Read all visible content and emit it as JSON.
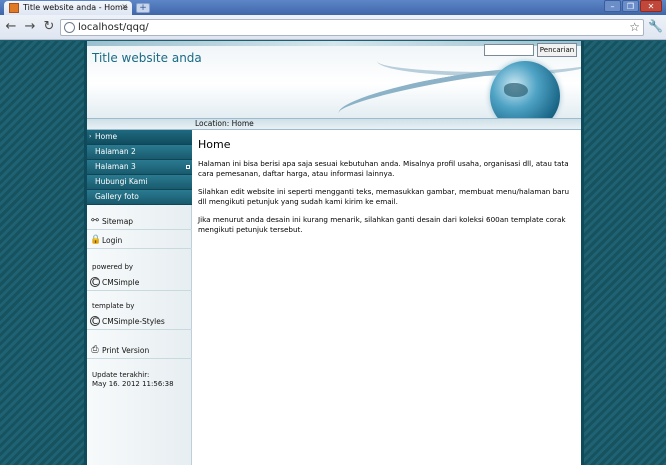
{
  "browser": {
    "tab_title": "Title website anda - Home",
    "tab_close": "×",
    "new_tab": "+",
    "window_min": "–",
    "window_max": "❐",
    "window_close": "✕",
    "back": "←",
    "forward": "→",
    "reload": "↻",
    "url": "localhost/qqq/",
    "bookmark_star": "☆",
    "settings": "🔧"
  },
  "site": {
    "title": "Title website anda",
    "search": {
      "value": "",
      "button_label": "Pencarian"
    },
    "location_label": "Location:  Home"
  },
  "sidebar": {
    "menu": [
      {
        "label": "Home",
        "active": true
      },
      {
        "label": "Halaman 2"
      },
      {
        "label": "Halaman 3",
        "has_submenu": true
      },
      {
        "label": "Hubungi Kami"
      },
      {
        "label": "Gallery foto"
      }
    ],
    "links": {
      "sitemap": {
        "icon": "sitemap-icon",
        "label": "Sitemap"
      },
      "login": {
        "icon": "lock-icon",
        "label": "Login"
      },
      "print": {
        "icon": "printer-icon",
        "label": "Print Version"
      }
    },
    "powered_by_label": "powered by",
    "cmsimple": {
      "icon": "copyright-icon",
      "label": "CMSimple"
    },
    "template_by_label": "template by",
    "cmsimple_styles": {
      "icon": "copyright-icon",
      "label": "CMSimple-Styles"
    },
    "update_label": "Update terakhir:",
    "update_value": "May 16. 2012 11:56:38"
  },
  "main": {
    "heading": "Home",
    "paragraphs": [
      "Halaman ini bisa berisi apa saja sesuai kebutuhan anda. Misalnya profil usaha, organisasi dll, atau tata cara pemesanan, daftar harga, atau informasi lainnya.",
      "Silahkan edit website ini seperti mengganti teks, memasukkan gambar, membuat menu/halaman baru dll mengikuti petunjuk yang sudah kami kirim ke email.",
      "Jika menurut anda desain ini kurang menarik, silahkan ganti desain dari koleksi 600an template corak mengikuti petunjuk tersebut."
    ]
  }
}
